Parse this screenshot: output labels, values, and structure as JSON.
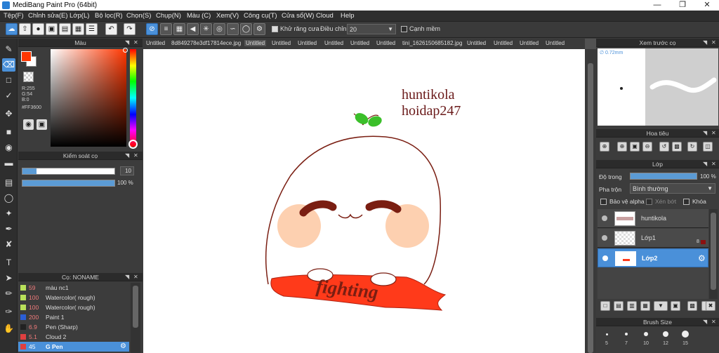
{
  "app": {
    "title": "MediBang Paint Pro (64bit)"
  },
  "window": {
    "minimize": "—",
    "maximize": "❐",
    "close": "✕"
  },
  "menu": [
    {
      "label": "Tệp(F)"
    },
    {
      "label": "Chỉnh sửa(E)"
    },
    {
      "label": "Lớp(L)"
    },
    {
      "label": "Bộ lọc(R)"
    },
    {
      "label": "Chọn(S)"
    },
    {
      "label": "Chụp(N)"
    },
    {
      "label": "Màu (C)"
    },
    {
      "label": "Xem(V)"
    },
    {
      "label": "Công cụ(T)"
    },
    {
      "label": "Cửa sổ(W)"
    },
    {
      "label": "Cloud"
    },
    {
      "label": "Help"
    }
  ],
  "toolbar": {
    "antialias_label": "Khử răng cưa",
    "adjust_label": "Điều chỉnh",
    "adjust_value": "20",
    "smooth_edge_label": "Cạnh mềm"
  },
  "color_panel": {
    "title": "Màu",
    "r": "R:255",
    "g": "G:54",
    "b": "B:0",
    "hex": "#FF3600",
    "fg_color": "#ff3600"
  },
  "brush_control": {
    "title": "Kiểm soát cọ",
    "size_value": "10",
    "size_fraction": 0.15,
    "opacity_value": "100 %",
    "opacity_fraction": 1.0
  },
  "brush_list": {
    "title": "Cọ: NONAME",
    "items": [
      {
        "num": "59",
        "name": "màu nc1",
        "color": "#b8e05a"
      },
      {
        "num": "100",
        "name": "Watercolor( rough)",
        "color": "#b8e05a"
      },
      {
        "num": "100",
        "name": "Watercolor( rough)",
        "color": "#b8e05a"
      },
      {
        "num": "200",
        "name": "Paint 1",
        "color": "#2b5ed6"
      },
      {
        "num": "6.9",
        "name": "Pen (Sharp)",
        "color": "#222222"
      },
      {
        "num": "5.1",
        "name": "Cloud 2",
        "color": "#e04040"
      },
      {
        "num": "45",
        "name": "G Pen",
        "color": "#e04040"
      }
    ]
  },
  "tabs": [
    {
      "label": "Untitled"
    },
    {
      "label": "8d849278e3df17814ece.jpg"
    },
    {
      "label": "Untitled"
    },
    {
      "label": "Untitled"
    },
    {
      "label": "Untitled"
    },
    {
      "label": "Untitled"
    },
    {
      "label": "Untitled"
    },
    {
      "label": "Untitled"
    },
    {
      "label": "tini_1626150685182.jpg"
    },
    {
      "label": "Untitled"
    },
    {
      "label": "Untitled"
    },
    {
      "label": "Untitled"
    },
    {
      "label": "Untitled"
    }
  ],
  "canvas": {
    "watermark_line1": "huntikola",
    "watermark_line2": "hoidap247",
    "banner_text": "fighting",
    "line_color": "#7a1e12",
    "banner_color": "#ff3a1a",
    "cheek_color": "#fdd0b0"
  },
  "preview": {
    "title": "Xem trước cọ",
    "size": "∅ 0.72mm"
  },
  "navigator": {
    "title": "Hoa tiêu"
  },
  "layers": {
    "title": "Lớp",
    "opacity_label": "Độ trong",
    "opacity_value": "100 %",
    "opacity_fraction": 1.0,
    "blend_label": "Pha trộn",
    "blend_value": "Bình thường",
    "protect_alpha": "Bảo vệ alpha",
    "clipping": "Xén bớt",
    "lock": "Khóa",
    "items": [
      {
        "name": "huntikola",
        "badge": ""
      },
      {
        "name": "Lớp1",
        "badge": "8"
      },
      {
        "name": "Lớp2",
        "badge": ""
      }
    ]
  },
  "brush_size": {
    "title": "Brush Size",
    "sizes": [
      "5",
      "7",
      "10",
      "12",
      "15"
    ]
  }
}
